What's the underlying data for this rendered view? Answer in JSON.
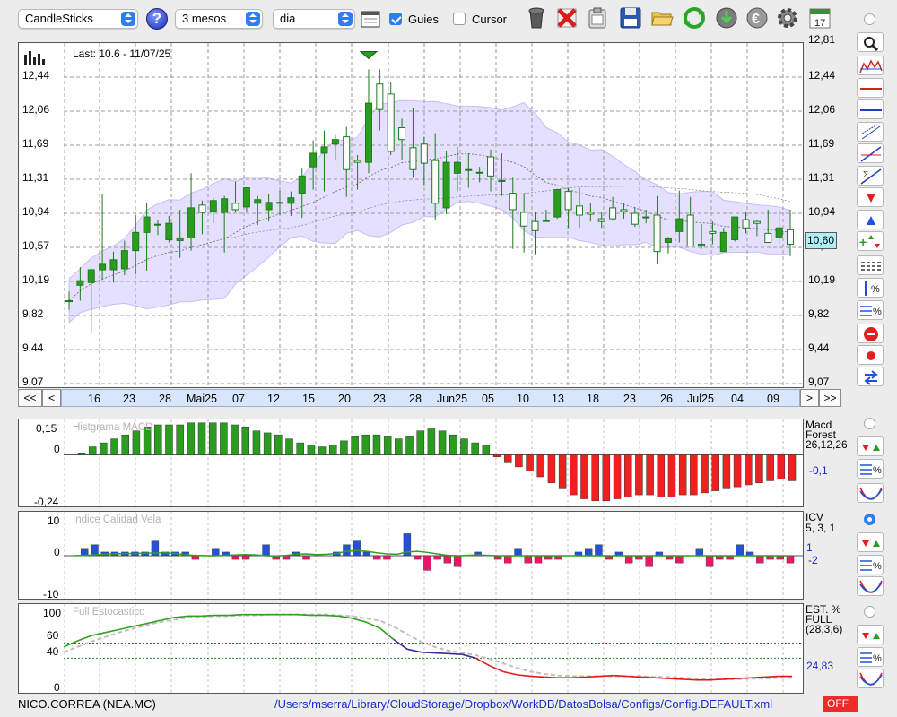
{
  "toolbar": {
    "chart_type": "CandleSticks",
    "period": "3 mesos",
    "interval": "dia",
    "guides_label": "Guies",
    "guides_checked": true,
    "cursor_label": "Cursor",
    "cursor_checked": false,
    "help_glyph": "?",
    "icons": [
      "calendar-icon",
      "trash-icon",
      "delete-x-icon",
      "clipboard-icon",
      "save-icon",
      "folder-open-icon",
      "refresh-icon",
      "download-icon",
      "euro-icon",
      "gear-icon",
      "calendar-17-icon"
    ],
    "calendar_day": "17"
  },
  "price_panel": {
    "last_label": "Last: 10.6 - 11/07/25",
    "last_value": "10,60",
    "y_ticks": [
      "12,81",
      "12,44",
      "12,06",
      "11,69",
      "11,31",
      "10,94",
      "10,57",
      "10,19",
      "9,82",
      "9,44",
      "9,07"
    ],
    "colors": {
      "up": "#2a9d1f",
      "down": "#ffffff",
      "band_fill": "#dcd5ff",
      "band_edge": "#c8bdf5",
      "ma": "#8a8aa8"
    }
  },
  "navigation": {
    "first": "<<",
    "prev": "<",
    "next": ">",
    "last": ">>",
    "dates": [
      "16",
      "23",
      "28",
      "Mai25",
      "07",
      "12",
      "15",
      "20",
      "23",
      "28",
      "Jun25",
      "05",
      "10",
      "13",
      "18",
      "23",
      "26",
      "Jul25",
      "04",
      "09"
    ]
  },
  "macd_panel": {
    "title": "Histgrama MACD",
    "y_ticks": [
      "0,15",
      "0",
      "-0,24"
    ],
    "side_label_1": "Macd",
    "side_label_2": "Forest",
    "side_label_3": "26,12,26",
    "side_value": "-0,1",
    "colors": {
      "positive": "#2a9d1f",
      "negative": "#f02020"
    }
  },
  "icv_panel": {
    "title": "Indice Calidad Vela",
    "y_ticks": [
      "10",
      "0",
      "-10"
    ],
    "side_label_1": "ICV",
    "side_label_2": "5, 3, 1",
    "side_value_1": "1",
    "side_value_2": "-2",
    "colors": {
      "positive": "#2451d6",
      "negative": "#e8186b",
      "line": "#2fa01f"
    }
  },
  "stoch_panel": {
    "title": "Full Estocastico",
    "y_ticks": [
      "100",
      "60",
      "40",
      "0"
    ],
    "side_label_1": "EST. %",
    "side_label_2": "FULL",
    "side_label_3": "(28,3,6)",
    "side_value": "24,83",
    "colors": {
      "high": "#2fa01f",
      "mid": "#3a2b8f",
      "low": "#e01a1a",
      "signal": "#c0c0c0"
    }
  },
  "status": {
    "ticker": "NICO.CORREA (NEA.MC)",
    "config_path": "/Users/mserra/Library/CloudStorage/Dropbox/WorkDB/DatosBolsa/Configs/Config.DEFAULT.xml",
    "mode": "OFF"
  },
  "chart_data": [
    {
      "type": "candlestick",
      "title": "",
      "ylim": [
        9.07,
        12.81
      ],
      "x_tick_labels": [
        "16",
        "23",
        "28",
        "Mai25",
        "07",
        "12",
        "15",
        "20",
        "23",
        "28",
        "Jun25",
        "05",
        "10",
        "13",
        "18",
        "23",
        "26",
        "Jul25",
        "04",
        "09"
      ],
      "candles": [
        {
          "o": 9.98,
          "h": 10.08,
          "l": 9.88,
          "c": 9.98
        },
        {
          "o": 10.15,
          "h": 10.35,
          "l": 9.98,
          "c": 10.2
        },
        {
          "o": 10.18,
          "h": 10.34,
          "l": 9.62,
          "c": 10.32
        },
        {
          "o": 10.32,
          "h": 11.15,
          "l": 10.21,
          "c": 10.38
        },
        {
          "o": 10.32,
          "h": 10.52,
          "l": 10.18,
          "c": 10.43
        },
        {
          "o": 10.33,
          "h": 10.64,
          "l": 10.26,
          "c": 10.53
        },
        {
          "o": 10.53,
          "h": 10.92,
          "l": 10.27,
          "c": 10.73
        },
        {
          "o": 10.73,
          "h": 11.05,
          "l": 10.31,
          "c": 10.9
        },
        {
          "o": 10.81,
          "h": 10.87,
          "l": 10.7,
          "c": 10.82
        },
        {
          "o": 10.65,
          "h": 10.91,
          "l": 10.62,
          "c": 10.83
        },
        {
          "o": 10.64,
          "h": 10.98,
          "l": 10.45,
          "c": 10.67
        },
        {
          "o": 10.67,
          "h": 11.38,
          "l": 10.53,
          "c": 11.0
        },
        {
          "o": 11.03,
          "h": 11.08,
          "l": 10.71,
          "c": 10.95
        },
        {
          "o": 10.96,
          "h": 11.11,
          "l": 10.83,
          "c": 11.08
        },
        {
          "o": 10.95,
          "h": 11.13,
          "l": 10.51,
          "c": 11.1
        },
        {
          "o": 11.05,
          "h": 11.29,
          "l": 10.95,
          "c": 10.98
        },
        {
          "o": 11.01,
          "h": 11.21,
          "l": 10.96,
          "c": 11.22
        },
        {
          "o": 11.05,
          "h": 11.13,
          "l": 10.81,
          "c": 11.09
        },
        {
          "o": 10.98,
          "h": 11.15,
          "l": 10.85,
          "c": 11.06
        },
        {
          "o": 11.05,
          "h": 11.19,
          "l": 10.92,
          "c": 11.06
        },
        {
          "o": 11.05,
          "h": 11.18,
          "l": 10.91,
          "c": 11.11
        },
        {
          "o": 11.16,
          "h": 11.43,
          "l": 10.89,
          "c": 11.35
        },
        {
          "o": 11.45,
          "h": 11.74,
          "l": 11.2,
          "c": 11.6
        },
        {
          "o": 11.6,
          "h": 11.85,
          "l": 11.18,
          "c": 11.67
        },
        {
          "o": 11.7,
          "h": 11.8,
          "l": 11.52,
          "c": 11.75
        },
        {
          "o": 11.78,
          "h": 11.89,
          "l": 11.12,
          "c": 11.42
        },
        {
          "o": 11.52,
          "h": 11.58,
          "l": 11.2,
          "c": 11.5
        },
        {
          "o": 11.5,
          "h": 12.52,
          "l": 11.38,
          "c": 12.15
        },
        {
          "o": 12.36,
          "h": 12.52,
          "l": 11.85,
          "c": 12.08
        },
        {
          "o": 12.25,
          "h": 12.38,
          "l": 11.58,
          "c": 11.62
        },
        {
          "o": 11.88,
          "h": 11.98,
          "l": 11.52,
          "c": 11.75
        },
        {
          "o": 11.66,
          "h": 12.1,
          "l": 11.33,
          "c": 11.42
        },
        {
          "o": 11.7,
          "h": 11.78,
          "l": 11.25,
          "c": 11.49
        },
        {
          "o": 11.52,
          "h": 11.82,
          "l": 10.87,
          "c": 11.05
        },
        {
          "o": 11.0,
          "h": 11.62,
          "l": 10.93,
          "c": 11.5
        },
        {
          "o": 11.38,
          "h": 11.67,
          "l": 11.18,
          "c": 11.5
        },
        {
          "o": 11.42,
          "h": 11.6,
          "l": 11.22,
          "c": 11.42
        },
        {
          "o": 11.39,
          "h": 11.45,
          "l": 11.28,
          "c": 11.39
        },
        {
          "o": 11.56,
          "h": 11.64,
          "l": 11.18,
          "c": 11.35
        },
        {
          "o": 11.3,
          "h": 11.6,
          "l": 11.13,
          "c": 11.29
        },
        {
          "o": 11.16,
          "h": 11.33,
          "l": 10.55,
          "c": 10.98
        },
        {
          "o": 10.95,
          "h": 11.16,
          "l": 10.51,
          "c": 10.8
        },
        {
          "o": 10.85,
          "h": 10.96,
          "l": 10.49,
          "c": 10.75
        },
        {
          "o": 10.86,
          "h": 10.98,
          "l": 10.86,
          "c": 10.86
        },
        {
          "o": 10.9,
          "h": 11.2,
          "l": 10.88,
          "c": 11.2
        },
        {
          "o": 11.18,
          "h": 11.22,
          "l": 10.78,
          "c": 10.98
        },
        {
          "o": 11.02,
          "h": 11.22,
          "l": 10.78,
          "c": 10.92
        },
        {
          "o": 10.95,
          "h": 11.05,
          "l": 10.85,
          "c": 10.93
        },
        {
          "o": 10.88,
          "h": 10.95,
          "l": 10.78,
          "c": 10.85
        },
        {
          "o": 11.0,
          "h": 11.12,
          "l": 10.86,
          "c": 10.88
        },
        {
          "o": 10.98,
          "h": 11.05,
          "l": 10.88,
          "c": 10.96
        },
        {
          "o": 10.94,
          "h": 11.01,
          "l": 10.79,
          "c": 10.82
        },
        {
          "o": 10.9,
          "h": 10.98,
          "l": 10.83,
          "c": 10.9
        },
        {
          "o": 10.92,
          "h": 11.13,
          "l": 10.38,
          "c": 10.52
        },
        {
          "o": 10.62,
          "h": 10.68,
          "l": 10.5,
          "c": 10.66
        },
        {
          "o": 10.74,
          "h": 11.19,
          "l": 10.62,
          "c": 10.88
        },
        {
          "o": 10.92,
          "h": 11.12,
          "l": 10.58,
          "c": 10.58
        },
        {
          "o": 10.58,
          "h": 10.82,
          "l": 10.55,
          "c": 10.6
        },
        {
          "o": 10.74,
          "h": 10.85,
          "l": 10.6,
          "c": 10.72
        },
        {
          "o": 10.52,
          "h": 10.78,
          "l": 10.52,
          "c": 10.73
        },
        {
          "o": 10.65,
          "h": 10.85,
          "l": 10.63,
          "c": 10.9
        },
        {
          "o": 10.87,
          "h": 10.95,
          "l": 10.72,
          "c": 10.78
        },
        {
          "o": 10.85,
          "h": 10.87,
          "l": 10.69,
          "c": 10.83
        },
        {
          "o": 10.72,
          "h": 10.98,
          "l": 10.63,
          "c": 10.62
        },
        {
          "o": 10.68,
          "h": 10.98,
          "l": 10.6,
          "c": 10.78
        },
        {
          "o": 10.76,
          "h": 10.98,
          "l": 10.47,
          "c": 10.6
        }
      ]
    },
    {
      "type": "bar",
      "title": "Histgrama MACD",
      "ylim": [
        -0.24,
        0.15
      ],
      "values": [
        0.01,
        0.04,
        0.06,
        0.08,
        0.1,
        0.12,
        0.14,
        0.15,
        0.15,
        0.15,
        0.16,
        0.16,
        0.16,
        0.16,
        0.15,
        0.14,
        0.12,
        0.11,
        0.1,
        0.08,
        0.06,
        0.05,
        0.04,
        0.05,
        0.07,
        0.09,
        0.1,
        0.1,
        0.09,
        0.08,
        0.09,
        0.12,
        0.13,
        0.12,
        0.1,
        0.08,
        0.06,
        0.05,
        -0.01,
        -0.04,
        -0.06,
        -0.08,
        -0.11,
        -0.14,
        -0.17,
        -0.2,
        -0.22,
        -0.23,
        -0.23,
        -0.22,
        -0.21,
        -0.2,
        -0.2,
        -0.21,
        -0.21,
        -0.2,
        -0.2,
        -0.19,
        -0.18,
        -0.17,
        -0.16,
        -0.15,
        -0.14,
        -0.13,
        -0.12,
        -0.13
      ]
    },
    {
      "type": "bar",
      "title": "Indice Calidad Vela",
      "ylim": [
        -10,
        10
      ],
      "values": [
        0,
        2,
        3,
        1,
        1,
        1,
        1,
        1,
        4,
        1,
        1,
        1,
        -1,
        0,
        2,
        1,
        -1,
        -1,
        0,
        3,
        -1,
        -1,
        1,
        -1,
        0,
        0,
        1,
        3,
        4,
        1,
        -1,
        -1,
        0,
        6,
        -1,
        -4,
        -1,
        -2,
        -3,
        0,
        1,
        0,
        -1,
        -2,
        2,
        -2,
        -2,
        -1,
        -1,
        0,
        1,
        2,
        3,
        -1,
        1,
        -2,
        -1,
        -3,
        1,
        -1,
        -2,
        0,
        2,
        -3,
        -1,
        -1,
        3,
        1,
        -2,
        -1,
        -1,
        -2
      ],
      "line_values": [
        0,
        0.1,
        0.2,
        0.4,
        0.5,
        0.6,
        0.6,
        0.7,
        0.7,
        0.8,
        0.6,
        0.2,
        0.1,
        0.0,
        0.0,
        0.1,
        0.2,
        0.3,
        0.2,
        0.0,
        -0.1,
        0.1,
        0.4,
        0.5,
        0.3,
        0.4,
        0.6,
        1.2,
        1.4,
        1.2,
        0.8,
        0.5,
        0.4,
        1.0,
        1.2,
        0.9,
        0.5,
        0.1,
        0.0,
        0.1,
        0.2,
        0.1,
        0.0,
        0.0,
        0.0,
        0.0,
        0.0,
        0.0,
        0.0,
        0.0,
        0.0,
        0.0,
        0.0,
        0.0,
        0.0,
        0.0,
        0.0,
        0.0,
        0.0,
        0.0,
        0.0,
        0.0,
        0.0,
        0.0,
        0.0,
        0.0,
        0.0,
        0.0,
        0.0,
        0.0,
        0.0,
        0.0
      ]
    },
    {
      "type": "line",
      "title": "Full Estocastico",
      "ylim": [
        0,
        100
      ],
      "k_values": [
        55,
        63,
        70,
        74,
        78,
        82,
        86,
        90,
        94,
        96,
        96,
        97,
        97,
        98,
        98,
        98,
        98,
        98,
        97,
        97,
        96,
        93,
        88,
        80,
        65,
        52,
        48,
        47,
        46,
        45,
        40,
        30,
        22,
        18,
        16,
        15,
        14,
        14,
        15,
        16,
        17,
        16,
        15,
        14,
        13,
        12,
        11,
        11,
        12,
        13,
        14,
        15,
        16,
        16
      ],
      "d_values": [
        48,
        55,
        62,
        68,
        74,
        79,
        84,
        88,
        91,
        94,
        95,
        96,
        96,
        97,
        97,
        98,
        98,
        98,
        98,
        98,
        97,
        96,
        93,
        90,
        82,
        72,
        62,
        55,
        50,
        47,
        44,
        39,
        33,
        27,
        22,
        19,
        17,
        16,
        16,
        16,
        16,
        16,
        16,
        15,
        15,
        14,
        13,
        12,
        12,
        12,
        13,
        13,
        14,
        14
      ]
    }
  ]
}
